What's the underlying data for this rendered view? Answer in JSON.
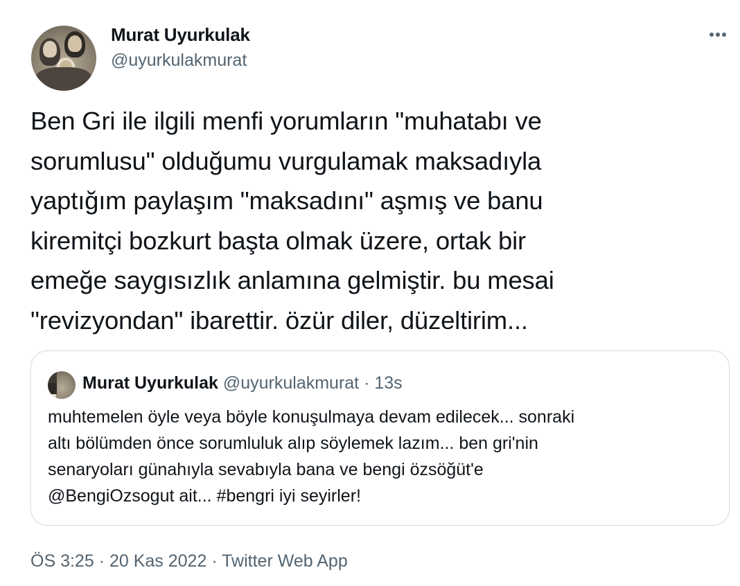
{
  "author": {
    "name": "Murat Uyurkulak",
    "handle": "@uyurkulakmurat"
  },
  "tweet": {
    "text": "Ben Gri ile ilgili menfi yorumların \"muhatabı ve\nsorumlusu\" olduğumu vurgulamak maksadıyla\nyaptığım paylaşım \"maksadını\" aşmış ve banu\nkiremitçi bozkurt başta olmak üzere, ortak bir\nemeğe saygısızlık anlamına gelmiştir. bu mesai\n\"revizyondan\"  ibarettir. özür diler, düzeltirim..."
  },
  "quoted": {
    "name": "Murat Uyurkulak",
    "handle": "@uyurkulakmurat",
    "separator": "·",
    "time": "13s",
    "text": "muhtemelen öyle veya böyle konuşulmaya devam edilecek... sonraki\naltı bölümden önce sorumluluk alıp söylemek lazım... ben gri'nin\nsenaryoları günahıyla sevabıyla bana ve bengi özsöğüt'e\n@BengiOzsogut ait... #bengri iyi seyirler!"
  },
  "meta": {
    "time": "ÖS 3:25",
    "separator": "·",
    "date": "20 Kas 2022",
    "source": "Twitter Web App"
  },
  "icons": {
    "more": "more-horizontal-icon"
  },
  "colors": {
    "text": "#0f1419",
    "secondary": "#536471",
    "border": "#cfd9de"
  }
}
